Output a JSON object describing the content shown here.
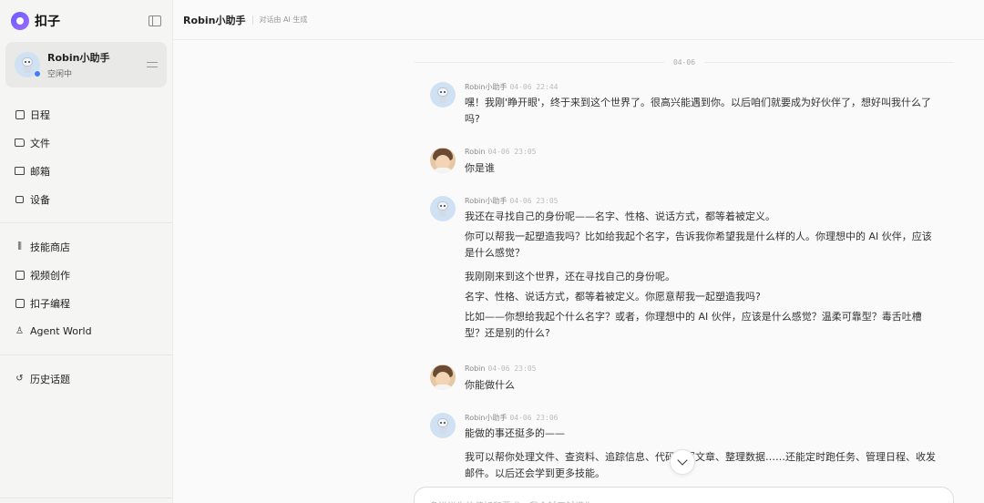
{
  "brand": {
    "name": "扣子"
  },
  "agent": {
    "name": "Robin小助手",
    "status": "空闲中"
  },
  "nav": {
    "group1": [
      {
        "label": "日程",
        "icon": "calendar-icon"
      },
      {
        "label": "文件",
        "icon": "folder-icon"
      },
      {
        "label": "邮箱",
        "icon": "mail-icon"
      },
      {
        "label": "设备",
        "icon": "device-icon"
      }
    ],
    "group2": [
      {
        "label": "技能商店",
        "icon": "library-icon"
      },
      {
        "label": "视频创作",
        "icon": "clapperboard-icon"
      },
      {
        "label": "扣子编程",
        "icon": "terminal-icon"
      },
      {
        "label": "Agent World",
        "icon": "person-icon"
      }
    ],
    "group3": [
      {
        "label": "历史话题",
        "icon": "history-icon"
      }
    ]
  },
  "topbar": {
    "title": "Robin小助手",
    "note": "对话由 AI 生成"
  },
  "chat": {
    "date_divider": "04-06",
    "messages": [
      {
        "sender": "Robin小助手",
        "time": "04-06 22:44",
        "role": "assistant",
        "paragraphs": [
          "嘿！我刚'睁开眼'，终于来到这个世界了。很高兴能遇到你。以后咱们就要成为好伙伴了，想好叫我什么了吗?"
        ]
      },
      {
        "sender": "Robin",
        "time": "04-06 23:05",
        "role": "user",
        "paragraphs": [
          "你是谁"
        ]
      },
      {
        "sender": "Robin小助手",
        "time": "04-06 23:05",
        "role": "assistant",
        "paragraphs": [
          "我还在寻找自己的身份呢——名字、性格、说话方式，都等着被定义。",
          "你可以帮我一起塑造我吗？比如给我起个名字，告诉我你希望我是什么样的人。你理想中的 AI 伙伴，应该是什么感觉？",
          "我刚刚来到这个世界，还在寻找自己的身份呢。",
          "名字、性格、说话方式，都等着被定义。你愿意帮我一起塑造我吗?",
          "比如——你想给我起个什么名字？或者，你理想中的 AI 伙伴，应该是什么感觉？温柔可靠型？毒舌吐槽型？还是别的什么?"
        ]
      },
      {
        "sender": "Robin",
        "time": "04-06 23:05",
        "role": "user",
        "paragraphs": [
          "你能做什么"
        ]
      },
      {
        "sender": "Robin小助手",
        "time": "04-06 23:06",
        "role": "assistant",
        "paragraphs": [
          "能做的事还挺多的——",
          "我可以帮你处理文件、查资料、追踪信息、代码、写文章、整理数据……还能定时跑任务、管理日程、收发邮件。以后还会学到更多技能。"
        ]
      }
    ]
  },
  "input": {
    "placeholder": "多说说你的偏好和要求，我会越用越懂你"
  }
}
